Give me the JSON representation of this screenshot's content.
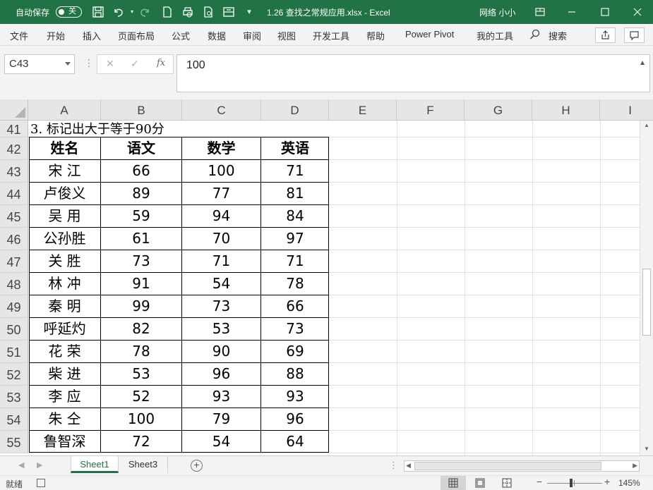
{
  "titlebar": {
    "autosave_label": "自动保存",
    "autosave_state": "关",
    "filename": "1.26 查找之常规应用.xlsx  -  Excel",
    "user": "网络 小小"
  },
  "ribbon": {
    "tabs": [
      "文件",
      "开始",
      "插入",
      "页面布局",
      "公式",
      "数据",
      "审阅",
      "视图",
      "开发工具",
      "帮助",
      "Power Pivot",
      "我的工具"
    ],
    "search_label": "搜索"
  },
  "formula_bar": {
    "name_box": "C43",
    "formula": "100",
    "fx": "fx"
  },
  "columns": [
    "A",
    "B",
    "C",
    "D",
    "E",
    "F",
    "G",
    "H",
    "I"
  ],
  "rows": [
    "41",
    "42",
    "43",
    "44",
    "45",
    "46",
    "47",
    "48",
    "49",
    "50",
    "51",
    "52",
    "53",
    "54",
    "55"
  ],
  "sheet_title": "3. 标记出大于等于90分",
  "table": {
    "headers": [
      "姓名",
      "语文",
      "数学",
      "英语"
    ],
    "rows": [
      [
        "宋 江",
        "66",
        "100",
        "71"
      ],
      [
        "卢俊义",
        "89",
        "77",
        "81"
      ],
      [
        "吴 用",
        "59",
        "94",
        "84"
      ],
      [
        "公孙胜",
        "61",
        "70",
        "97"
      ],
      [
        "关 胜",
        "73",
        "71",
        "71"
      ],
      [
        "林 冲",
        "91",
        "54",
        "78"
      ],
      [
        "秦 明",
        "99",
        "73",
        "66"
      ],
      [
        "呼延灼",
        "82",
        "53",
        "73"
      ],
      [
        "花 荣",
        "78",
        "90",
        "69"
      ],
      [
        "柴 进",
        "53",
        "96",
        "88"
      ],
      [
        "李 应",
        "52",
        "93",
        "93"
      ],
      [
        "朱 仝",
        "100",
        "79",
        "96"
      ],
      [
        "鲁智深",
        "72",
        "54",
        "64"
      ]
    ]
  },
  "sheets": [
    "Sheet1",
    "Sheet3"
  ],
  "active_sheet": "Sheet1",
  "status": {
    "ready": "就绪",
    "zoom": "145%"
  },
  "colors": {
    "accent": "#217346"
  }
}
